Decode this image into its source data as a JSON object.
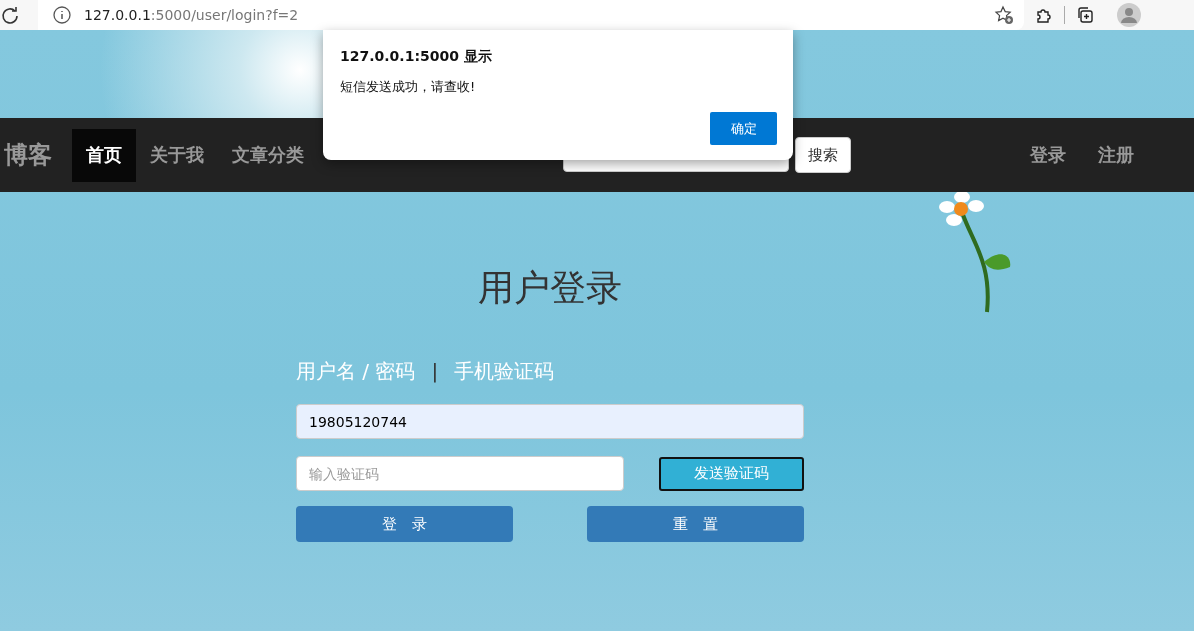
{
  "browser": {
    "url_host": "127.0.0.1",
    "url_rest": ":5000/user/login?f=2"
  },
  "nav": {
    "logo": "博客",
    "items": [
      {
        "label": "首页",
        "selected": true
      },
      {
        "label": "关于我",
        "selected": false
      },
      {
        "label": "文章分类",
        "selected": false
      }
    ],
    "search_button": "搜索",
    "auth": [
      "登录",
      "注册"
    ]
  },
  "login": {
    "title": "用户登录",
    "tabs": [
      "用户名 / 密码",
      "手机验证码"
    ],
    "separator": "|",
    "phone": {
      "value": "19805120744"
    },
    "code": {
      "placeholder": "输入验证码"
    },
    "send_button": "发送验证码",
    "buttons": [
      "登　录",
      "重　置"
    ]
  },
  "dialog": {
    "title": "127.0.0.1:5000 显示",
    "message": "短信发送成功，请查收!",
    "ok": "确定"
  }
}
